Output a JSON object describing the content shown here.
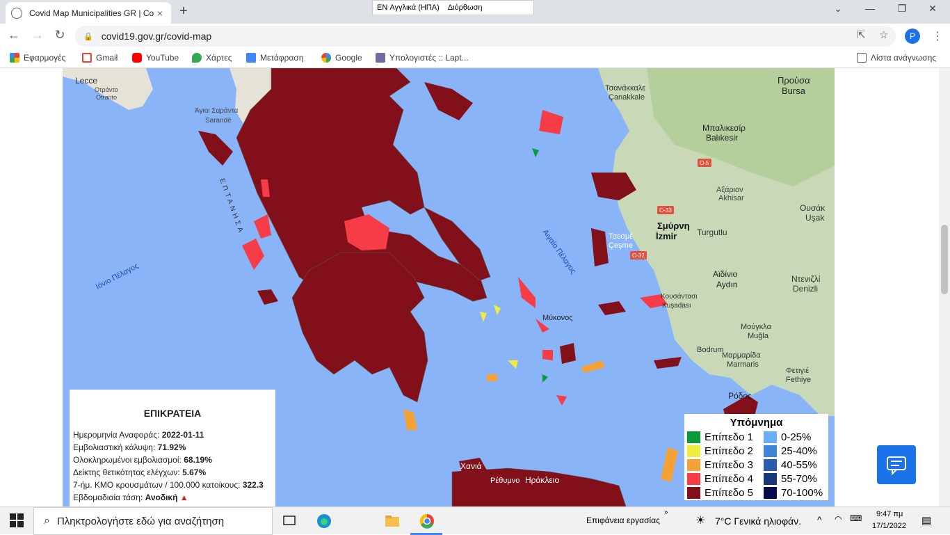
{
  "browser": {
    "tab_title": "Covid Map Municipalities GR | Co",
    "tab_close": "×",
    "new_tab": "+",
    "ime_lang": "EN Αγγλικά (ΗΠΑ)",
    "ime_label": "Διόρθωση",
    "win_min": "⌄",
    "win_minimize": "—",
    "win_restore": "❐",
    "win_close": "✕",
    "url": "covid19.gov.gr/covid-map",
    "avatar_letter": "P"
  },
  "bookmarks": [
    {
      "label": "Εφαρμογές",
      "color": "#ea4335"
    },
    {
      "label": "Gmail",
      "color": "#ea4335"
    },
    {
      "label": "YouTube",
      "color": "#ff0000"
    },
    {
      "label": "Χάρτες",
      "color": "#34a853"
    },
    {
      "label": "Μετάφραση",
      "color": "#4285f4"
    },
    {
      "label": "Google",
      "color": "#4285f4"
    },
    {
      "label": "Υπολογιστές :: Lapt...",
      "color": "#6d6d9e"
    }
  ],
  "reading_list": "Λίστα ανάγνωσης",
  "map": {
    "sea_label_1": "Ιόνιο Πέλαγος",
    "sea_label_2": "Αιγαίο Πέλαγος",
    "ionian_vertical": "ΕΠΤΑΝΗΣΑ",
    "places": [
      {
        "label": "Lecce"
      },
      {
        "label": "Οτράντο"
      },
      {
        "label": "Otranto"
      },
      {
        "label": "Άγιοι Σαράντα"
      },
      {
        "label": "Sarandë"
      },
      {
        "label": "Τσανάκκαλε"
      },
      {
        "label": "Çanakkale"
      },
      {
        "label": "Προύσα"
      },
      {
        "label": "Bursa"
      },
      {
        "label": "Μπαλικεσίρ"
      },
      {
        "label": "Balıkesir"
      },
      {
        "label": "Αξάριον"
      },
      {
        "label": "Akhisar"
      },
      {
        "label": "Ουσάκ"
      },
      {
        "label": "Uşak"
      },
      {
        "label": "Σμύρνη"
      },
      {
        "label": "İzmir"
      },
      {
        "label": "Turgutlu"
      },
      {
        "label": "Τσεσμέ"
      },
      {
        "label": "Çeşme"
      },
      {
        "label": "Αϊδίνιο"
      },
      {
        "label": "Aydın"
      },
      {
        "label": "Ντενιζλί"
      },
      {
        "label": "Denizli"
      },
      {
        "label": "Κουσάντασι"
      },
      {
        "label": "Kuşadası"
      },
      {
        "label": "Μούγκλα"
      },
      {
        "label": "Muğla"
      },
      {
        "label": "Bodrum"
      },
      {
        "label": "Μαρμαρίδα"
      },
      {
        "label": "Marmaris"
      },
      {
        "label": "Φετιγιέ"
      },
      {
        "label": "Fethiye"
      },
      {
        "label": "Ρόδος"
      },
      {
        "label": "Μύκονος"
      },
      {
        "label": "Χανιά"
      },
      {
        "label": "Ρέθυμνο"
      },
      {
        "label": "Ηράκλειο"
      }
    ],
    "road_labels": [
      "O-5",
      "O-33",
      "O-32"
    ]
  },
  "info_panel": {
    "title": "ΕΠΙΚΡΑΤΕΙΑ",
    "rows": [
      {
        "label": "Ημερομηνία Αναφοράς: ",
        "value": "2022-01-11"
      },
      {
        "label": "Εμβολιαστική κάλυψη: ",
        "value": "71.92%"
      },
      {
        "label": "Ολοκληρωμένοι εμβολιασμοί: ",
        "value": "68.19%"
      },
      {
        "label": "Δείκτης θετικότητας ελέγχων: ",
        "value": "5.67%"
      },
      {
        "label": "7-ήμ. ΚΜΟ κρουσμάτων / 100.000 κατοίκους: ",
        "value": "322.3"
      },
      {
        "label": "Εβδομαδιαία τάση: ",
        "value": "Ανοδική"
      }
    ],
    "trend_icon": "up-arrow"
  },
  "legend": {
    "title": "Υπόμνημα",
    "levels": [
      {
        "label": "Επίπεδο 1",
        "color": "#0a9a3a"
      },
      {
        "label": "Επίπεδο 2",
        "color": "#f2ec3c"
      },
      {
        "label": "Επίπεδο 3",
        "color": "#f4a236"
      },
      {
        "label": "Επίπεδο 4",
        "color": "#f63c46"
      },
      {
        "label": "Επίπεδο 5",
        "color": "#82101a"
      }
    ],
    "ranges": [
      {
        "label": "0-25%",
        "color": "#69aef6"
      },
      {
        "label": "25-40%",
        "color": "#3f84d6"
      },
      {
        "label": "40-55%",
        "color": "#2a5cab"
      },
      {
        "label": "55-70%",
        "color": "#16377a"
      },
      {
        "label": "70-100%",
        "color": "#060a4a"
      }
    ]
  },
  "taskbar": {
    "search_placeholder": "Πληκτρολογήστε εδώ για αναζήτηση",
    "desktop_label": "Επιφάνεια εργασίας",
    "weather": "7°C  Γενικά ηλιοφάν.",
    "time": "9:47 πμ",
    "date": "17/1/2022"
  }
}
